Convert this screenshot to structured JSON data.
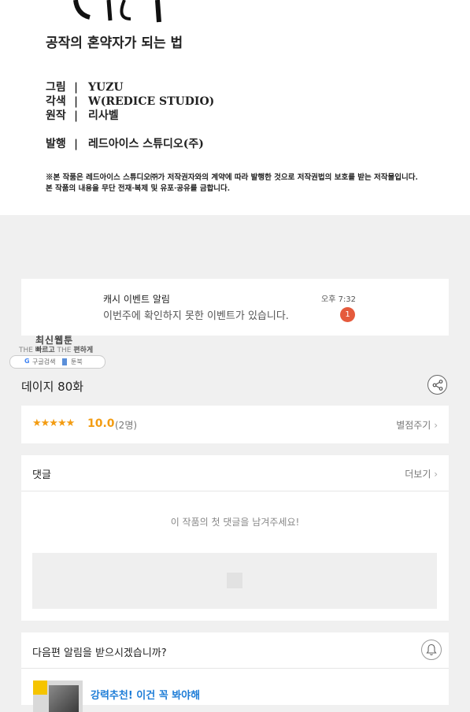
{
  "credits": {
    "subtitle": "공작의 혼약자가 되는 법",
    "rows": [
      {
        "key": "그림",
        "sep": "|",
        "value": "YUZU"
      },
      {
        "key": "각색",
        "sep": "|",
        "value": "W(REDICE STUDIO)"
      },
      {
        "key": "원작",
        "sep": "|",
        "value": "리사벨"
      },
      {
        "key": "발행",
        "sep": "|",
        "value": "레드아이스 스튜디오(주)"
      }
    ],
    "notice_line1": "※본 작품은 레드아이스 스튜디오㈜가 저작권자와의 계약에 따라 발행한 것으로 저작권법의 보호를 받는 저작물입니다.",
    "notice_line2": "본 작품의 내용을 무단 전재·복제 및 유포·공유를 금합니다."
  },
  "notification": {
    "title": "캐시 이벤트 알림",
    "time": "오후 7:32",
    "message": "이번주에 확인하지 못한 이벤트가 있습니다.",
    "badge": "1"
  },
  "ad_tag": {
    "title": "최신웹툰",
    "line_prefix1": "THE",
    "line_word1": "빠르고",
    "line_prefix2": "THE",
    "line_word2": "편하게",
    "pill_left": "구글검색",
    "pill_right": "툰북"
  },
  "episode": {
    "title": "데이지 80화"
  },
  "rating": {
    "stars": "★★★★★",
    "score": "10.0",
    "count": "(2명)",
    "rate_link": "별점주기"
  },
  "comments": {
    "header": "댓글",
    "more": "더보기",
    "empty_message": "이 작품의 첫 댓글을 남겨주세요!"
  },
  "next_episode": {
    "question": "다음편 알림을 받으시겠습니까?",
    "promo_title": "강력추천! 이건 꼭 봐야해"
  },
  "colors": {
    "accent_orange": "#f39c12",
    "badge_red": "#e55a3c",
    "link_blue": "#1e7dd7"
  },
  "icons": {
    "share": "share-icon",
    "bell": "bell-icon",
    "chevron": "chevron-right-icon",
    "google": "google-icon",
    "clock": "clock-icon"
  }
}
